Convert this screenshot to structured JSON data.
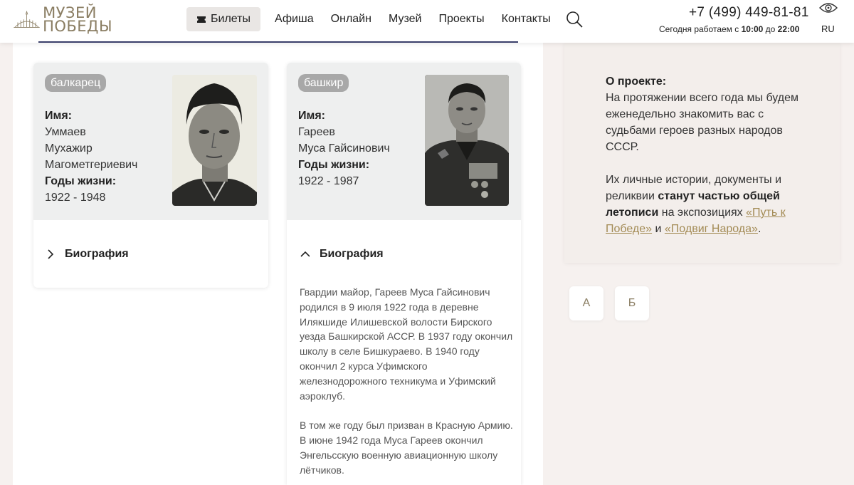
{
  "header": {
    "logo_line1": "МУЗЕЙ",
    "logo_line2": "ПОБЕДЫ",
    "nav": {
      "tickets": "Билеты",
      "items": [
        "Афиша",
        "Онлайн",
        "Музей",
        "Проекты",
        "Контакты"
      ]
    },
    "phone": "+7 (499) 449-81-81",
    "hours_prefix": "Сегодня работаем с",
    "hours_from": "10:00",
    "hours_mid": "до",
    "hours_to": "22:00",
    "lang": "RU"
  },
  "cards": [
    {
      "nationality": "балкарец",
      "name_label": "Имя:",
      "name_lines": [
        "Уммаев",
        "Мухажир",
        "Магометгериевич"
      ],
      "years_label": "Годы жизни:",
      "years": "1922 - 1948",
      "bio_label": "Биография",
      "bio_expanded": false
    },
    {
      "nationality": "башкир",
      "name_label": "Имя:",
      "name_lines": [
        "Гареев",
        "Муса Гайсинович"
      ],
      "years_label": "Годы жизни:",
      "years": "1922 - 1987",
      "bio_label": "Биография",
      "bio_expanded": true,
      "bio_paragraphs": [
        "Гвардии майор, Гареев Муса Гайсинович родился в 9 июля 1922 года в деревне Илякшиде Илишевской волости Бирского уезда Башкирской АССР. В 1937 году окончил школу в селе Бишкураево. В 1940 году окончил 2 курса Уфимского железнодорожного техникума и Уфимский аэроклуб.",
        "В том же году был призван в Красную Армию. В июне 1942 года Муса Гареев окончил Энгельсскую военную авиационную школу лётчиков."
      ]
    }
  ],
  "about": {
    "title": "О проекте:",
    "p1": "На протяжении всего года мы будем еженедельно знакомить вас с судьбами героев разных народов СССР.",
    "p2_start": "Их личные истории, документы и реликвии",
    "p2_bold": "станут частью общей летописи",
    "p2_mid": "на экспозициях",
    "link1": "«Путь к Победе»",
    "p2_and": "и",
    "link2": "«Подвиг Народа»",
    "p2_end": "."
  },
  "letters": [
    "А",
    "Б"
  ],
  "colors": {
    "accent": "#8a7d62",
    "link": "#a38b55",
    "badge": "#a8a8a8",
    "rule": "#3a3f6a",
    "page_bg": "#f6f1ef"
  }
}
